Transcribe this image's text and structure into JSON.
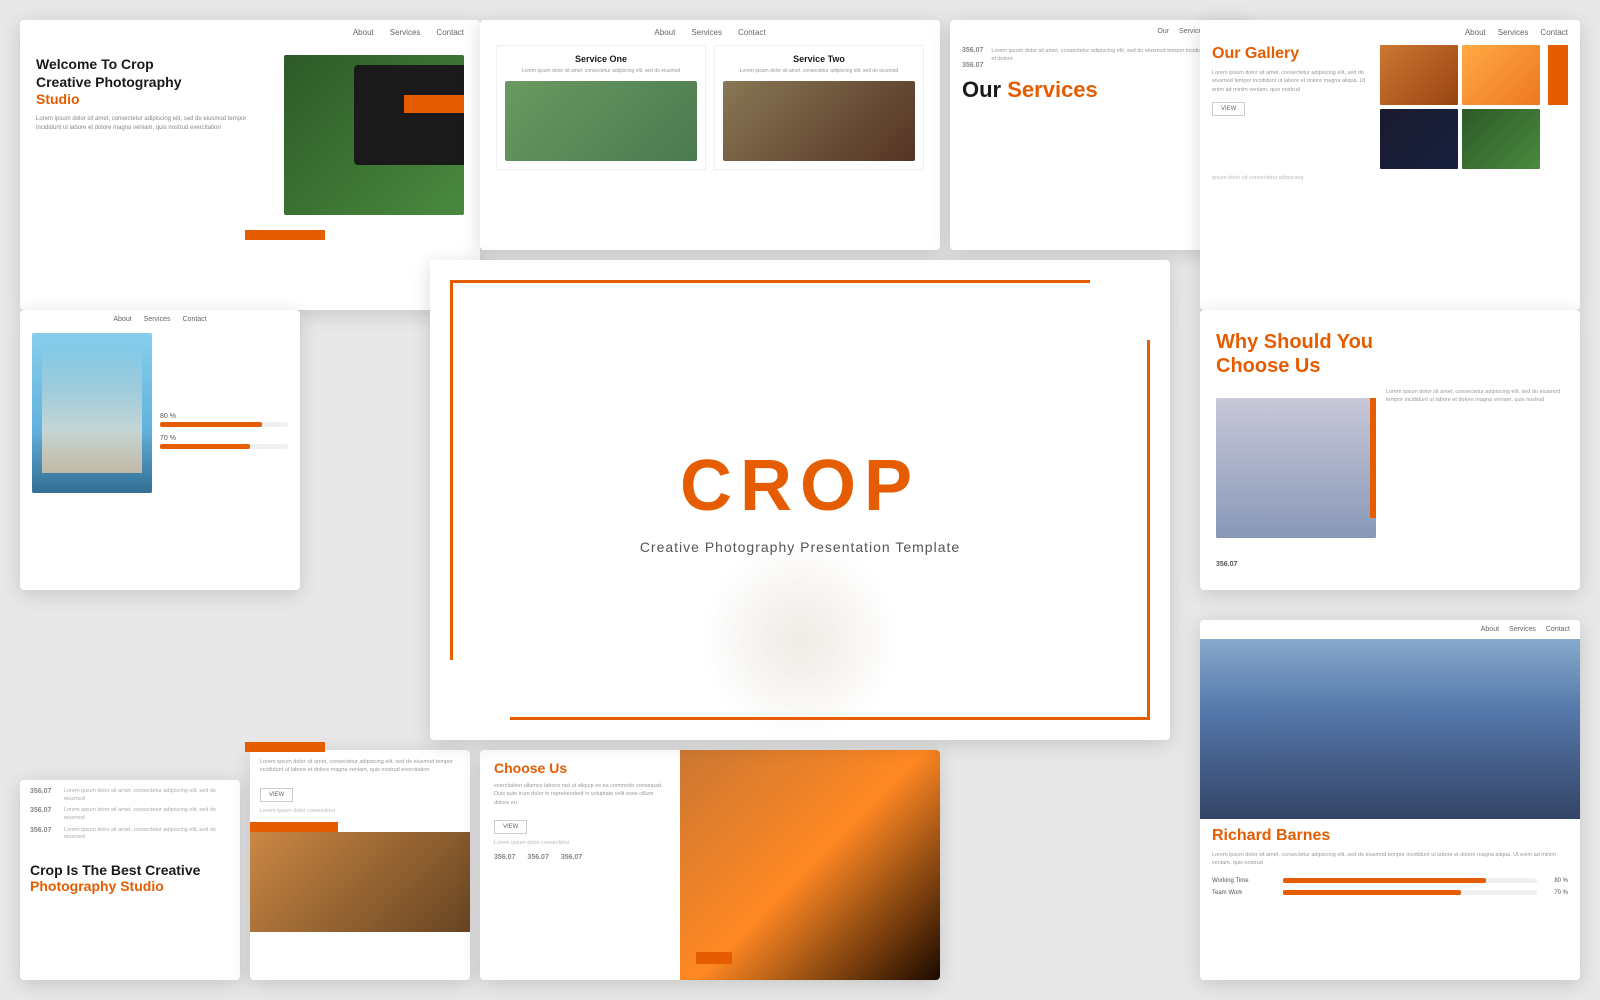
{
  "hero": {
    "brand_c": "C",
    "brand_rest": "ROP",
    "subtitle": "Creative Photography Presentation Template"
  },
  "welcome_slide": {
    "nav": [
      "About",
      "Services",
      "Contact"
    ],
    "title_line1": "Welcome To Crop",
    "title_line2": "Creative Photography",
    "title_orange": "Studio",
    "body_text": "Lorem ipsum dolor sit amet, consectetur adipiscing elit, sed do eiusmod tempor incididunt ut labore et dolore magna veniam, quis nostrud exercitation"
  },
  "services_slide": {
    "nav": [
      "About",
      "Services",
      "Contact"
    ],
    "service_one": "Service One",
    "service_one_text": "Lorem ipsum dolor sit amet, consectetur adipiscing elit, sed do eiusmod",
    "service_two": "Service Two",
    "service_two_text": "Lorem ipsum dolor sit amet, consectetur adipiscing elit, sed do eiusmod"
  },
  "our_services": {
    "label_our": "Our",
    "label_services": "Services",
    "num1": "356.07",
    "num2": "356.07",
    "text": "Lorem ipsum dolor sit amet, consectetur adipiscing elit, sed do eiusmod tempor incididunt ut labore et dolore"
  },
  "gallery_slide": {
    "nav": [
      "About",
      "Services",
      "Contact"
    ],
    "title_our": "Our",
    "title_gallery": "Gallery",
    "body": "Lorem ipsum dolor sit amet, consectetur adipiscing elit, sed do eiusmod tempor incididunt ut labore et dolore magna aliqua. Ut enim ad minim veniam, quis nostrud",
    "view_btn": "VIEW"
  },
  "stats_slide": {
    "nav": [
      "About",
      "Services",
      "Contact"
    ],
    "bar1_label": "80 %",
    "bar1_pct": 80,
    "bar2_label": "70 %",
    "bar2_pct": 70
  },
  "why_choose": {
    "title_why": "Why Should You",
    "title_choose": "Choose Us",
    "text": "Lorem ipsum dolor sit amet, consectetur adipiscing elit, sed do eiusmod tempor incididunt ut labore et dolore magna veniam, quis nostrud",
    "number": "356.07"
  },
  "bottom_left": {
    "num1": "356.07",
    "text1": "Lorem ipsum dolor sit amet, consectetur adipiscing elit, sed do eiusmod",
    "num2": "356.07",
    "text2": "Lorem ipsum dolor sit amet, consectetur adipiscing elit, sed do eiusmod",
    "num3": "356.07",
    "text3": "Lorem ipsum dolor sit amet, consectetur adipiscing elit, sed do eiusmod",
    "title1": "Crop Is The Best Creative",
    "title2": "Photography Studio"
  },
  "bottom_center_left": {
    "body": "Lorem ipsum dolor sit amet, consectetur adipiscing elit, sed do eiusmod tempor incididunt ut labore et dolore magna veniam, quis nostrud exercitation",
    "view_btn": "VIEW",
    "lorem": "Lorem ipsum dolor consectetur"
  },
  "choose_slide": {
    "title": "Choose Us",
    "body": "exercitation ullamco laboris nisi ut aliquip ex ea commodo consequat. Duis aute irure dolor in reprehenderit in voluptate velit esse cillum dolore eu",
    "view_btn": "VIEW",
    "lorem": "Lorem ipsum dolor consectetur",
    "num1": "356.07",
    "num2": "356.07",
    "num3": "356.07"
  },
  "richard": {
    "nav": [
      "About",
      "Services",
      "Contact"
    ],
    "name_orange": "Richard",
    "name_rest": "Barnes",
    "bio": "Lorem ipsum dolor sit amet, consectetur adipiscing elit, sed do eiusmod tempor incididunt ut labore et dolore magna aliqua. Ut enim ad minim veniam, quis nostrud",
    "bar1_label": "Working Time",
    "bar1_pct": 80,
    "bar1_val": "80 %",
    "bar2_label": "Team Work",
    "bar2_pct": 70,
    "bar2_val": "70 %"
  },
  "mid_services": {
    "nav": [
      "About",
      "Services",
      "Contact"
    ],
    "title_our": "Our",
    "title_services": "Services",
    "num1": "356.07",
    "text1": "Lorem ipsum dolor sit amet",
    "num2": "356.07",
    "text2": "Lorem ipsum dolor sit amet"
  },
  "gallery_overlay": {
    "text": "ipsum dolor sit consectetur adipiscing"
  }
}
